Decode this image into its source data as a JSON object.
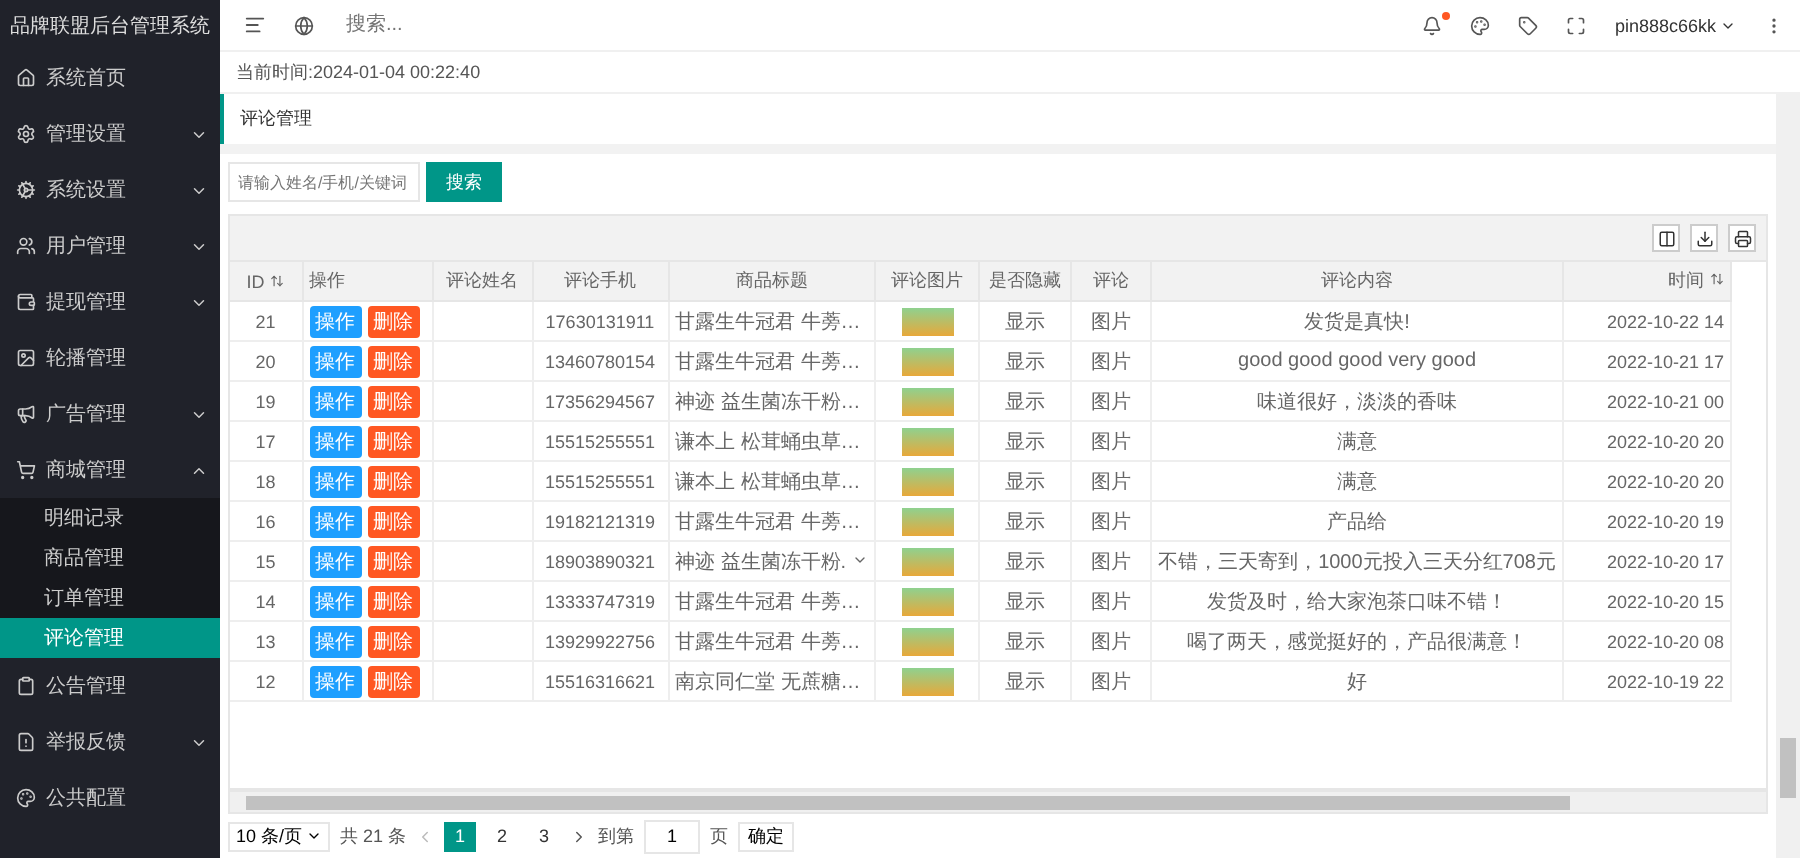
{
  "sidebar": {
    "title": "品牌联盟后台管理系统",
    "items": [
      {
        "label": "系统首页",
        "selected": false
      },
      {
        "label": "管理设置",
        "selected": false,
        "expanded": false
      },
      {
        "label": "系统设置",
        "selected": false,
        "expanded": false
      },
      {
        "label": "用户管理",
        "selected": false,
        "expanded": false
      },
      {
        "label": "提现管理",
        "selected": false,
        "expanded": false
      },
      {
        "label": "轮播管理",
        "selected": false
      },
      {
        "label": "广告管理",
        "selected": false,
        "expanded": false
      },
      {
        "label": "商城管理",
        "selected": false,
        "expanded": true,
        "children": [
          {
            "label": "明细记录",
            "selected": false
          },
          {
            "label": "商品管理",
            "selected": false
          },
          {
            "label": "订单管理",
            "selected": false
          },
          {
            "label": "评论管理",
            "selected": true
          }
        ]
      },
      {
        "label": "公告管理",
        "selected": false
      },
      {
        "label": "举报反馈",
        "selected": false,
        "expanded": false
      },
      {
        "label": "公共配置",
        "selected": false
      }
    ]
  },
  "header": {
    "search_placeholder": "搜索...",
    "notification_dot": true,
    "username": "pin888c66kk"
  },
  "current_time": "当前时间:2024-01-04 00:22:40",
  "page_tab": "评论管理",
  "search": {
    "placeholder": "请输入姓名/手机/关键词",
    "button": "搜索"
  },
  "table": {
    "columns": [
      "ID",
      "操作",
      "评论姓名",
      "评论手机",
      "商品标题",
      "评论图片",
      "是否隐藏",
      "评论",
      "评论内容",
      "时间"
    ],
    "rows": [
      {
        "id": "21",
        "actions": [
          "操作",
          "删除"
        ],
        "name": "",
        "phone": "17630131911",
        "title": "甘露生牛冠君 牛蒡…",
        "hidden": "显示",
        "comment": "图片",
        "content": "发货是真快!",
        "time": "2022-10-22 14",
        "hovered": false
      },
      {
        "id": "20",
        "actions": [
          "操作",
          "删除"
        ],
        "name": "",
        "phone": "13460780154",
        "title": "甘露生牛冠君 牛蒡…",
        "hidden": "显示",
        "comment": "图片",
        "content": "good good good very good",
        "time": "2022-10-21 17",
        "hovered": false
      },
      {
        "id": "19",
        "actions": [
          "操作",
          "删除"
        ],
        "name": "",
        "phone": "17356294567",
        "title": "神迹 益生菌冻干粉…",
        "hidden": "显示",
        "comment": "图片",
        "content": "味道很好，淡淡的香味",
        "time": "2022-10-21 00",
        "hovered": false
      },
      {
        "id": "17",
        "actions": [
          "操作",
          "删除"
        ],
        "name": "",
        "phone": "15515255551",
        "title": "谦本上 松茸蛹虫草…",
        "hidden": "显示",
        "comment": "图片",
        "content": "满意",
        "time": "2022-10-20 20",
        "hovered": false
      },
      {
        "id": "18",
        "actions": [
          "操作",
          "删除"
        ],
        "name": "",
        "phone": "15515255551",
        "title": "谦本上 松茸蛹虫草…",
        "hidden": "显示",
        "comment": "图片",
        "content": "满意",
        "time": "2022-10-20 20",
        "hovered": false
      },
      {
        "id": "16",
        "actions": [
          "操作",
          "删除"
        ],
        "name": "",
        "phone": "19182121319",
        "title": "甘露生牛冠君 牛蒡…",
        "hidden": "显示",
        "comment": "图片",
        "content": "产品给",
        "time": "2022-10-20 19",
        "hovered": false
      },
      {
        "id": "15",
        "actions": [
          "操作",
          "删除"
        ],
        "name": "",
        "phone": "18903890321",
        "title": "神迹 益生菌冻干粉.",
        "hidden": "显示",
        "comment": "图片",
        "content": "不错，三天寄到，1000元投入三天分红708元",
        "time": "2022-10-20 17",
        "hovered": true
      },
      {
        "id": "14",
        "actions": [
          "操作",
          "删除"
        ],
        "name": "",
        "phone": "13333747319",
        "title": "甘露生牛冠君 牛蒡…",
        "hidden": "显示",
        "comment": "图片",
        "content": "发货及时，给大家泡茶口味不错！",
        "time": "2022-10-20 15",
        "hovered": false
      },
      {
        "id": "13",
        "actions": [
          "操作",
          "删除"
        ],
        "name": "",
        "phone": "13929922756",
        "title": "甘露生牛冠君 牛蒡…",
        "hidden": "显示",
        "comment": "图片",
        "content": "喝了两天，感觉挺好的，产品很满意！",
        "time": "2022-10-20 08",
        "hovered": false
      },
      {
        "id": "12",
        "actions": [
          "操作",
          "删除"
        ],
        "name": "",
        "phone": "15516316621",
        "title": "南京同仁堂 无蔗糖…",
        "hidden": "显示",
        "comment": "图片",
        "content": "好",
        "time": "2022-10-19 22",
        "hovered": false
      }
    ]
  },
  "pagination": {
    "page_size": "10 条/页",
    "total": "共 21 条",
    "pages": [
      {
        "label": "1",
        "selected": true
      },
      {
        "label": "2",
        "selected": false
      },
      {
        "label": "3",
        "selected": false
      }
    ],
    "goto_label": "到第",
    "goto_value": "1",
    "page_unit": "页",
    "confirm": "确定"
  }
}
